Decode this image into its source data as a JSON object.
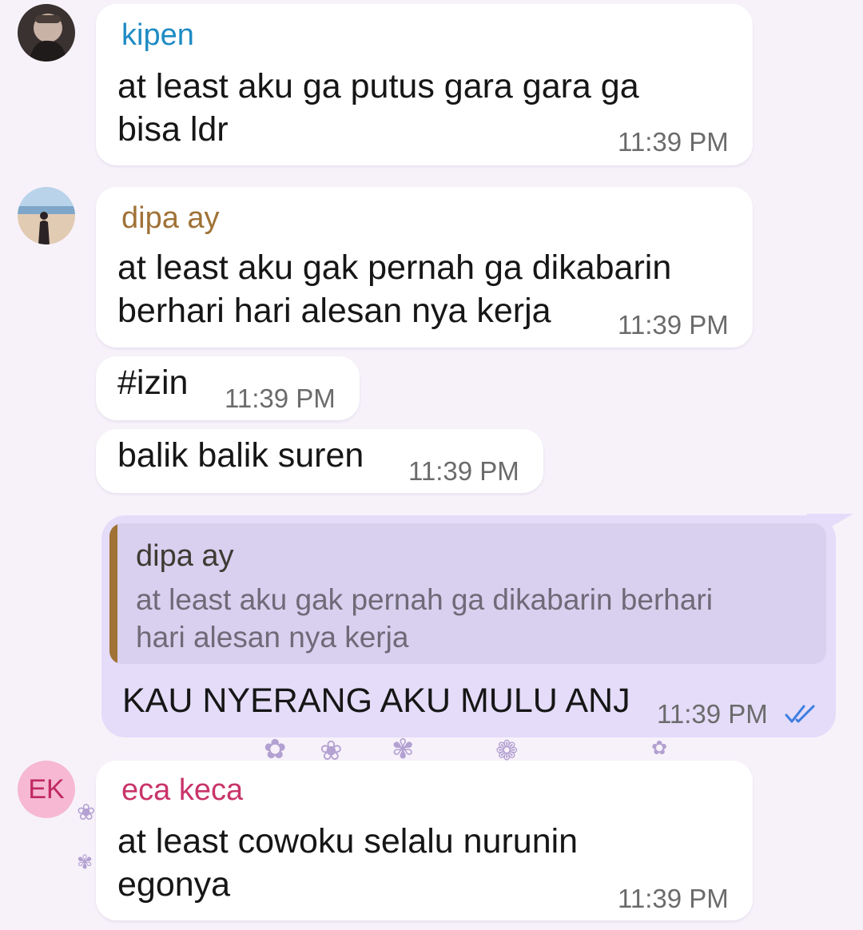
{
  "colors": {
    "kipen": "#1e8bc3",
    "dipa": "#a07236",
    "eca": "#c93469",
    "outgoing_bubble": "#e4dcf9",
    "read_check": "#3d7ee0"
  },
  "messages": [
    {
      "sender": "kipen",
      "avatar_icon": "photo-avatar-icon",
      "lines": [
        "at least aku ga putus gara gara ga",
        "bisa ldr"
      ],
      "time": "11:39 PM"
    },
    {
      "sender": "dipa ay",
      "avatar_icon": "photo-avatar-icon",
      "lines": [
        "at least aku gak pernah ga dikabarin",
        "berhari hari alesan nya kerja"
      ],
      "time": "11:39 PM"
    },
    {
      "sender": "",
      "lines": [
        "#izin"
      ],
      "time": "11:39 PM"
    },
    {
      "sender": "",
      "lines": [
        "balik balik suren"
      ],
      "time": "11:39 PM"
    },
    {
      "outgoing": true,
      "reply_to": {
        "name": "dipa ay",
        "lines": [
          "at least aku gak pernah ga dikabarin berhari",
          "hari alesan nya kerja"
        ]
      },
      "lines": [
        "KAU NYERANG AKU MULU ANJ"
      ],
      "time": "11:39 PM",
      "status_icon": "double-check-icon"
    },
    {
      "sender": "eca keca",
      "avatar_initials": "EK",
      "lines": [
        "at least cowoku selalu nurunin",
        "egonya"
      ],
      "time": "11:39 PM"
    }
  ]
}
